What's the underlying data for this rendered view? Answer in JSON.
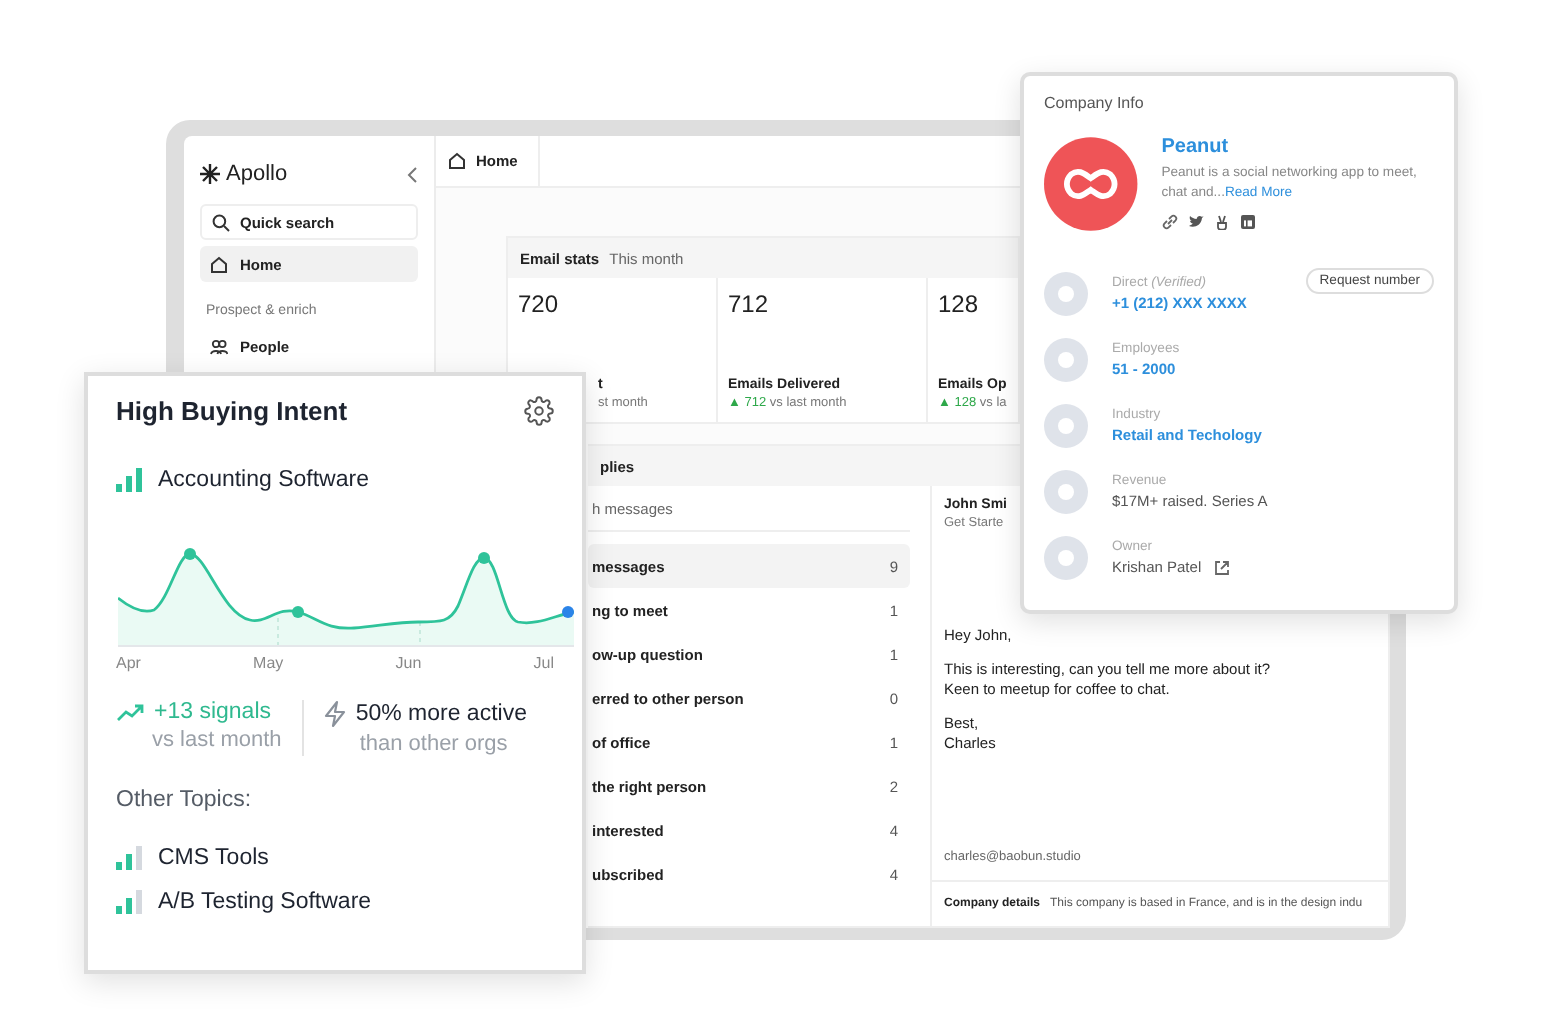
{
  "app_window": {
    "sidebar": {
      "logo": "Apollo",
      "search": {
        "placeholder": "Quick search"
      },
      "nav": [
        {
          "kind": "item",
          "label": "Home",
          "selected": true
        },
        {
          "kind": "section",
          "label": "Prospect & enrich"
        },
        {
          "kind": "item",
          "label": "People",
          "selected": false
        }
      ]
    },
    "tab": {
      "label": "Home"
    },
    "email_stats": {
      "title": "Email stats",
      "period": "This month",
      "stats": [
        {
          "value": "720",
          "label": "t",
          "delta_text": "st month"
        },
        {
          "value": "712",
          "label": "Emails Delivered",
          "delta": "▲ 712",
          "delta_text": "vs last month"
        },
        {
          "value": "128",
          "label": "Emails Op",
          "delta": "▲ 128",
          "delta_text": "vs la"
        }
      ]
    },
    "replies": {
      "title": "plies",
      "search": {
        "placeholder": "h messages"
      },
      "rows": [
        {
          "label": "messages",
          "count": "9",
          "selected": true
        },
        {
          "label": "ng to meet",
          "count": "1",
          "selected": false
        },
        {
          "label": "ow-up question",
          "count": "1",
          "selected": false
        },
        {
          "label": "erred to other person",
          "count": "0",
          "selected": false
        },
        {
          "label": "of office",
          "count": "1",
          "selected": false
        },
        {
          "label": "the right person",
          "count": "2",
          "selected": false
        },
        {
          "label": "interested",
          "count": "4",
          "selected": false
        },
        {
          "label": "ubscribed",
          "count": "4",
          "selected": false
        }
      ]
    },
    "email": {
      "sender": "John Smi",
      "subject": "Get Starte",
      "body": [
        "Hey John,",
        "This is interesting, can you tell me more about it?\nKeen to meetup for coffee to chat.",
        "Best,\nCharles"
      ],
      "signature": "charles@baobun.studio",
      "footer": {
        "label": "Company details",
        "text": "This company is based in France, and is in the design indu"
      }
    }
  },
  "company_info": {
    "title": "Company Info",
    "name": "Peanut",
    "description": "Peanut is a social networking app to meet, chat and...",
    "read_more": "Read More",
    "fields": [
      {
        "label": "Direct *(Verified)*",
        "value": "+1 (212) XXX XXXX",
        "link": true,
        "action": "Request number"
      },
      {
        "label": "Employees",
        "value": "51 - 2000",
        "link": true
      },
      {
        "label": "Industry",
        "value": "Retail and Techology",
        "link": true
      },
      {
        "label": "Revenue",
        "value": "$17M+ raised. Series A",
        "link": false
      },
      {
        "label": "Owner",
        "value": "Krishan Patel",
        "link": false,
        "external": true
      }
    ]
  },
  "buying_intent": {
    "title": "High Buying Intent",
    "topic": {
      "label": "Accounting Software",
      "level": 1
    },
    "months": [
      "Apr",
      "May",
      "Jun",
      "Jul"
    ],
    "signals": {
      "value": "+13 signals",
      "caption": "vs last month"
    },
    "activity": {
      "value": "50% more active",
      "caption": "than other orgs"
    },
    "other_title": "Other Topics:",
    "other_topics": [
      {
        "label": "CMS Tools",
        "level": 0.67
      },
      {
        "label": "A/B Testing Software",
        "level": 0.67
      }
    ]
  }
}
